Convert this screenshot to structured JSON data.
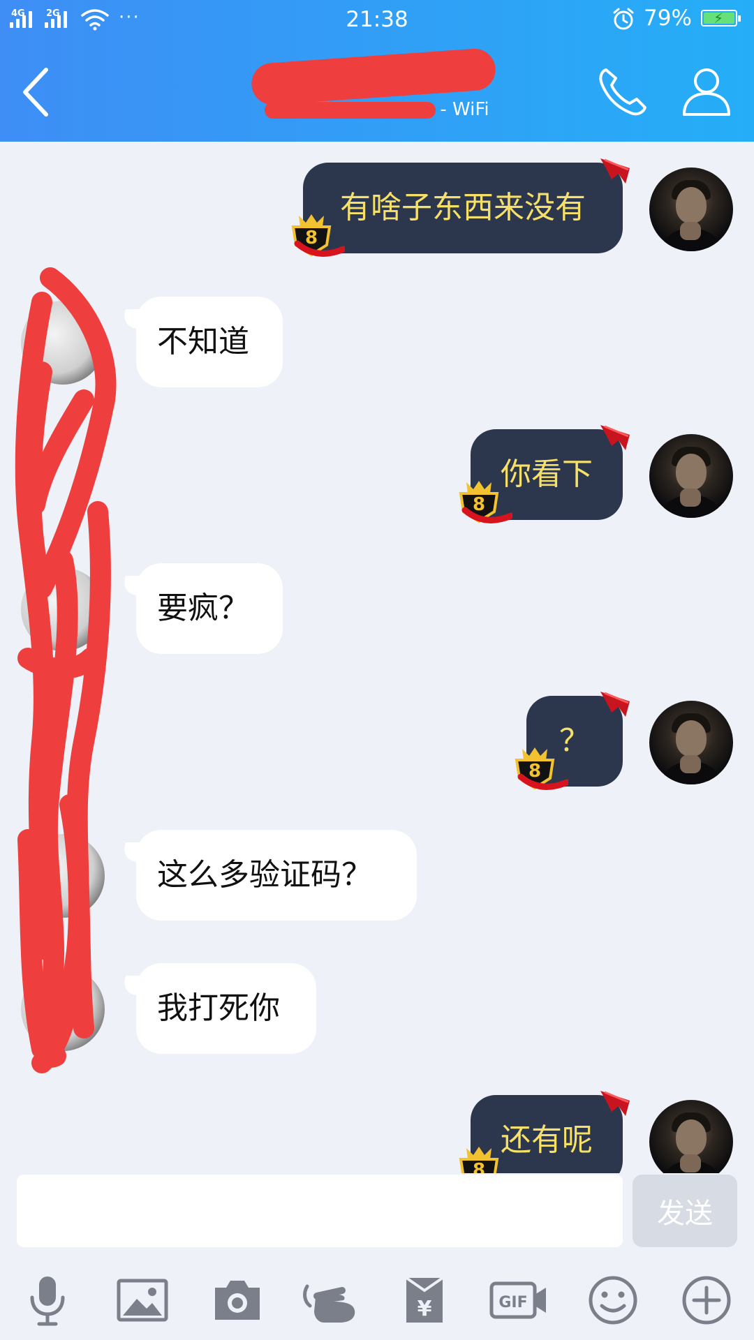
{
  "status_bar": {
    "sim1": "4G",
    "sim2": "2G",
    "more": "···",
    "time": "21:38",
    "battery": "79%"
  },
  "header": {
    "subtitle": "- WiFi",
    "back_icon": "chevron-left-icon",
    "call_icon": "phone-icon",
    "profile_icon": "person-icon"
  },
  "messages": [
    {
      "dir": "out",
      "text": "有啥子东西来没有"
    },
    {
      "dir": "in",
      "text": "不知道"
    },
    {
      "dir": "out",
      "text": "你看下"
    },
    {
      "dir": "in",
      "text": "要疯？"
    },
    {
      "dir": "out",
      "text": "？"
    },
    {
      "dir": "in",
      "text": "这么多验证码？"
    },
    {
      "dir": "in",
      "text": "我打死你"
    },
    {
      "dir": "out",
      "text": "还有呢"
    }
  ],
  "composer": {
    "placeholder": "",
    "send_label": "发送"
  },
  "toolbar": {
    "gif_label": "GIF",
    "icons": [
      "microphone-icon",
      "image-icon",
      "camera-icon",
      "poke-icon",
      "red-packet-icon",
      "gif-icon",
      "emoji-icon",
      "plus-icon"
    ]
  },
  "colors": {
    "header_start": "#3e8ef5",
    "header_end": "#25aef7",
    "outgoing_bubble": "#2c374d",
    "outgoing_text": "#f6e06a",
    "incoming_bubble": "#ffffff",
    "chat_background": "#eef1f7",
    "redaction": "#ef3e3e"
  }
}
